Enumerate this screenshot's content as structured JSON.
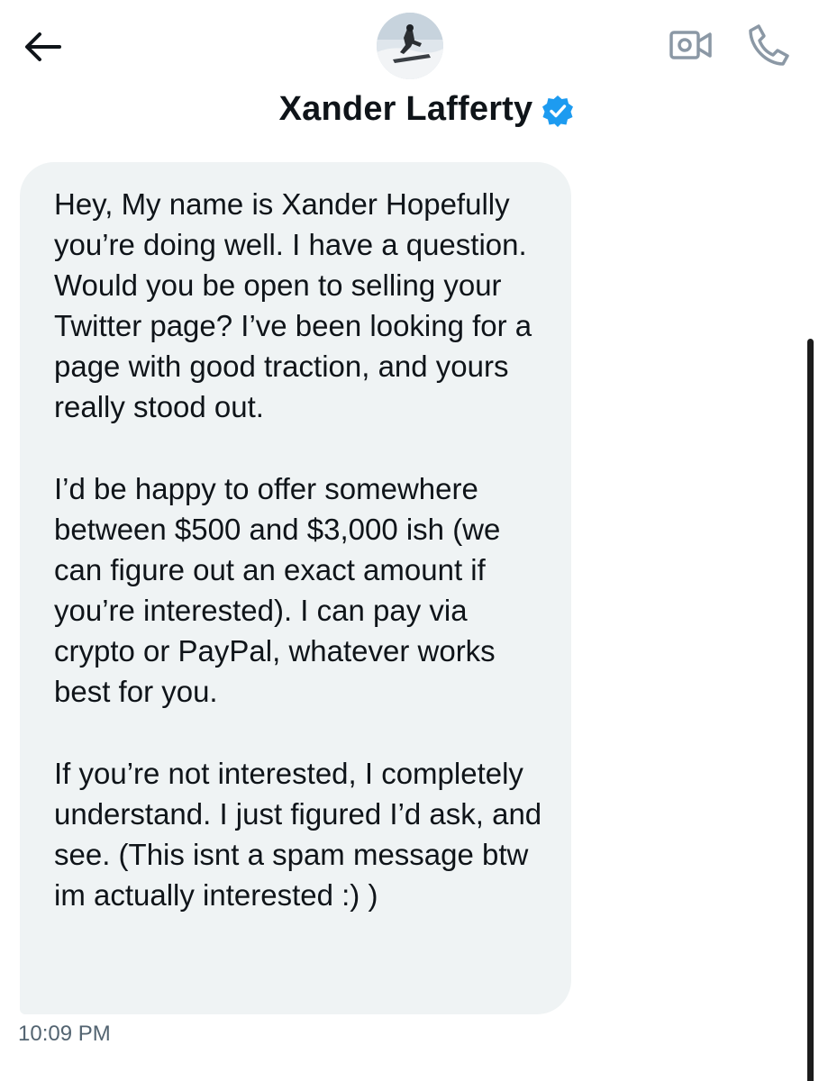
{
  "header": {
    "contact_name": "Xander Lafferty",
    "verified": true,
    "icons": {
      "back": "arrow-left-icon",
      "video": "video-camera-icon",
      "call": "phone-icon",
      "verified": "verified-badge-icon"
    }
  },
  "colors": {
    "verified_blue": "#1d9bf0",
    "bubble_background": "#eff3f4",
    "text_primary": "#0f1419",
    "text_secondary": "#536471",
    "icon_gray": "#8b98a5"
  },
  "message": {
    "paragraphs": [
      "Hey, My name is Xander Hopefully you’re doing well. I have a question. Would you be open to selling your Twitter page? I’ve been looking for a page with good traction, and yours really stood out.",
      "I’d be happy to offer somewhere between $500 and $3,000 ish (we can figure out an exact amount if you’re interested). I can pay via crypto or PayPal, whatever works best for you.",
      "If you’re not interested, I completely understand. I just figured I’d ask, and see. (This isnt a spam message btw im actually interested :) )"
    ],
    "timestamp": "10:09 PM"
  }
}
